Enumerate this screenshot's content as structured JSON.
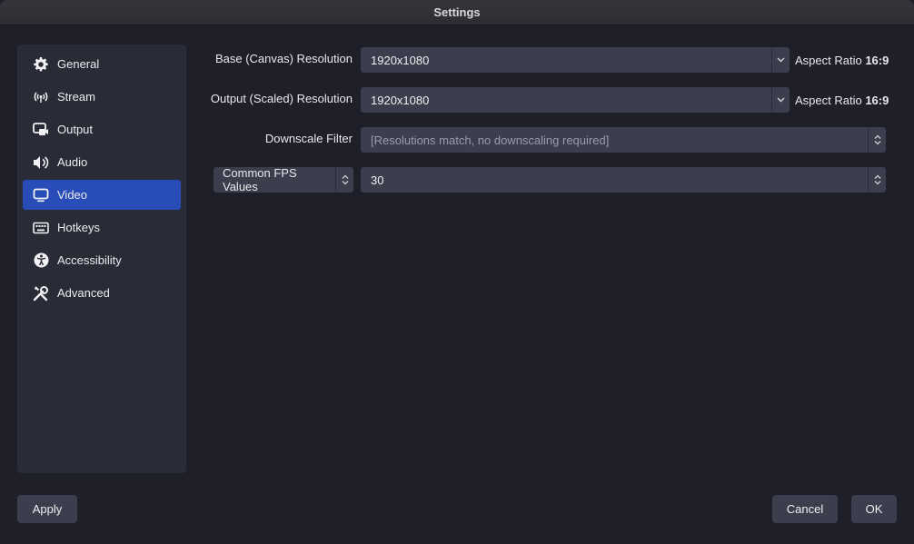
{
  "window": {
    "title": "Settings"
  },
  "sidebar": {
    "items": [
      {
        "label": "General",
        "icon": "gear-icon"
      },
      {
        "label": "Stream",
        "icon": "broadcast-icon"
      },
      {
        "label": "Output",
        "icon": "output-icon"
      },
      {
        "label": "Audio",
        "icon": "speaker-icon"
      },
      {
        "label": "Video",
        "icon": "monitor-icon",
        "active": true
      },
      {
        "label": "Hotkeys",
        "icon": "keyboard-icon"
      },
      {
        "label": "Accessibility",
        "icon": "accessibility-icon"
      },
      {
        "label": "Advanced",
        "icon": "tools-icon"
      }
    ]
  },
  "video": {
    "base_label": "Base (Canvas) Resolution",
    "base_value": "1920x1080",
    "base_aspect_prefix": "Aspect Ratio",
    "base_aspect_value": "16:9",
    "output_label": "Output (Scaled) Resolution",
    "output_value": "1920x1080",
    "output_aspect_prefix": "Aspect Ratio",
    "output_aspect_value": "16:9",
    "filter_label": "Downscale Filter",
    "filter_value": "[Resolutions match, no downscaling required]",
    "fps_type": "Common FPS Values",
    "fps_value": "30"
  },
  "buttons": {
    "apply": "Apply",
    "cancel": "Cancel",
    "ok": "OK"
  },
  "colors": {
    "accent": "#284cb8",
    "background": "#1e1f29",
    "panel": "#292b37",
    "control": "#3b3e4c"
  }
}
